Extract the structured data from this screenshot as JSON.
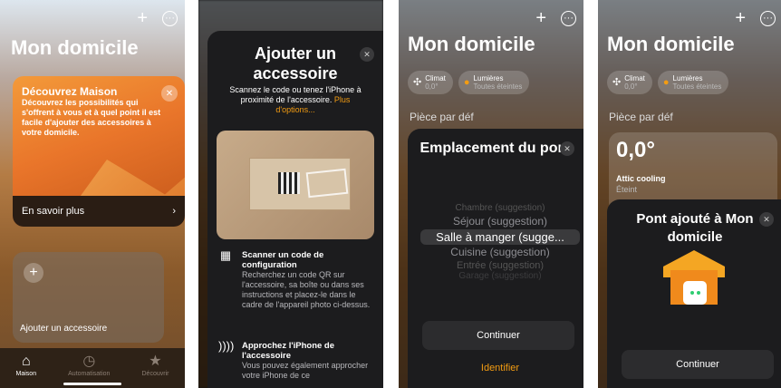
{
  "panel1": {
    "title": "Mon domicile",
    "plus_glyph": "+",
    "more_glyph": "···",
    "promo": {
      "title": "Découvrez Maison",
      "text": "Découvrez les possibilités qui s'offrent à vous et à quel point il est facile d'ajouter des accessoires à votre domicile.",
      "close_glyph": "✕",
      "footer_label": "En savoir plus",
      "footer_chevron": "›"
    },
    "add_tile": {
      "plus_glyph": "+",
      "label": "Ajouter un accessoire"
    },
    "tabs": [
      {
        "label": "Maison",
        "icon": "house-icon",
        "glyph": "⌂"
      },
      {
        "label": "Automatisation",
        "icon": "clock-icon",
        "glyph": "◷"
      },
      {
        "label": "Découvrir",
        "icon": "star-icon",
        "glyph": "★"
      }
    ]
  },
  "panel2": {
    "title": "Ajouter un accessoire",
    "subtitle": "Scannez le code ou tenez l'iPhone à proximité de l'accessoire.",
    "more_options": "Plus d'options...",
    "close_glyph": "✕",
    "steps": [
      {
        "icon": "qr-code-icon",
        "glyph": "▦",
        "title": "Scanner un code de configuration",
        "text": "Recherchez un code QR sur l'accessoire, sa boîte ou dans ses instructions et placez-le dans le cadre de l'appareil photo ci-dessus."
      },
      {
        "icon": "nfc-icon",
        "glyph": "))))",
        "title": "Approchez l'iPhone de l'accessoire",
        "text": "Vous pouvez également approcher votre iPhone de ce"
      }
    ]
  },
  "panel3": {
    "title": "Mon domicile",
    "chips": [
      {
        "icon": "fan-icon",
        "glyph": "✣",
        "title": "Climat",
        "value": "0,0°"
      },
      {
        "icon": "bulb-icon",
        "glyph": "●",
        "title": "Lumières",
        "value": "Toutes éteintes"
      }
    ],
    "section": "Pièce par déf",
    "sheet_title": "Emplacement du pont",
    "close_glyph": "✕",
    "picker": [
      "Chambre (suggestion)",
      "Séjour (suggestion)",
      "Salle à manger (sugge...",
      "Cuisine (suggestion)",
      "Entrée (suggestion)",
      "Garage (suggestion)"
    ],
    "continue": "Continuer",
    "identify": "Identifier"
  },
  "panel4": {
    "title": "Mon domicile",
    "section": "Pièce par déf",
    "tile": {
      "value": "0,0°",
      "name": "Attic cooling",
      "state": "Éteint"
    },
    "sheet_title": "Pont ajouté à Mon domicile",
    "close_glyph": "✕",
    "continue": "Continuer"
  },
  "colors": {
    "accent": "#f39c12",
    "sheet": "#1c1c1e"
  }
}
